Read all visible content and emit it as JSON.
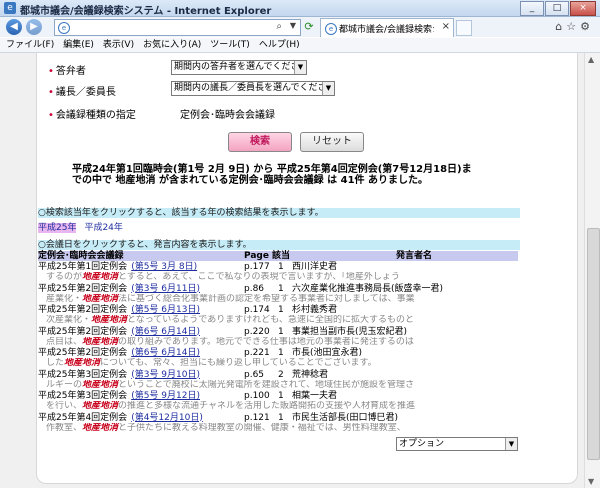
{
  "window": {
    "title": "都城市議会/会議録検索システム - Internet Explorer",
    "minimize": "_",
    "restore": "□",
    "close": "×"
  },
  "navbar": {
    "back": "◀",
    "forward": "▶",
    "address_placeholder": "",
    "tab_title": "都城市議会/会議録検索シ...",
    "tab_close": "×",
    "right_icons": "⌂☆⚙"
  },
  "menu": [
    "ファイル(F)",
    "編集(E)",
    "表示(V)",
    "お気に入り(A)",
    "ツール(T)",
    "ヘルプ(H)"
  ],
  "form": {
    "answerer_label": "答弁者",
    "answerer_select": "期間内の答弁者を選んでください",
    "chair_label": "議長／委員長",
    "chair_select": "期間内の議長／委員長を選んでください",
    "type_label": "会議録種類の指定",
    "type_value": "定例会･臨時会会議録",
    "search_button": "検索",
    "reset_button": "リセット"
  },
  "summary": "平成24年第1回臨時会(第1号 2月 9日)  から   平成25年第4回定例会(第7号12月18日)までの中で  地産地消  が含まれている定例会･臨時会会議録  は  41件  ありました。",
  "year_info": "○検索該当年をクリックすると、該当する年の検索結果を表示します。",
  "years": [
    "平成25年",
    "平成24年"
  ],
  "date_info": "○会議日をクリックすると、発言内容を表示します。",
  "columns": {
    "meeting": "定例会･臨時会会議録",
    "page": "Page",
    "hit": "該当",
    "speaker": "発言者名"
  },
  "results": [
    {
      "meeting": "平成25年第1回定例会",
      "date": "(第5号 3月 8日)",
      "page": "p.177",
      "hit": "1",
      "speaker": "西川洋史君",
      "snippet_pre": "するのが",
      "keyword": "地産地消",
      "snippet_post": "とすると、あえて、ここで私なりの表現で言いますが、「地産外しょう"
    },
    {
      "meeting": "平成25年第2回定例会",
      "date": "(第3号 6月11日)",
      "page": "p.86",
      "hit": "1",
      "speaker": "六次産業化推進事務局長(飯盛幸一君)",
      "snippet_pre": "産業化・",
      "keyword": "地産地消",
      "snippet_post": "法に基づく総合化事業計画の認定を希望する事業者に対しましては、事業"
    },
    {
      "meeting": "平成25年第2回定例会",
      "date": "(第5号 6月13日)",
      "page": "p.174",
      "hit": "1",
      "speaker": "杉村義秀君",
      "snippet_pre": "次産業化・",
      "keyword": "地産地消",
      "snippet_post": "となっているようでありますけれども、急速に全国的に拡大するものと"
    },
    {
      "meeting": "平成25年第2回定例会",
      "date": "(第6号 6月14日)",
      "page": "p.220",
      "hit": "1",
      "speaker": "事業担当副市長(児玉宏紀君)",
      "snippet_pre": "点目は、",
      "keyword": "地産地消",
      "snippet_post": "の取り組みであります。地元でできる仕事は地元の事業者に発注するのは"
    },
    {
      "meeting": "平成25年第2回定例会",
      "date": "(第6号 6月14日)",
      "page": "p.221",
      "hit": "1",
      "speaker": "市長(池田宜永君)",
      "snippet_pre": "した",
      "keyword": "地産地消",
      "snippet_post": "についても、常々、担当にも繰り返し申していることでございます。"
    },
    {
      "meeting": "平成25年第3回定例会",
      "date": "(第3号 9月10日)",
      "page": "p.65",
      "hit": "2",
      "speaker": "荒神稔君",
      "snippet_pre": "ルギーの",
      "keyword": "地産地消",
      "snippet_post": "ということで廃校に太陽光発電所を建設されて、地域住民が施設を管理さ"
    },
    {
      "meeting": "平成25年第3回定例会",
      "date": "(第5号 9月12日)",
      "page": "p.100",
      "hit": "1",
      "speaker": "相葉一夫君",
      "snippet_pre": "を行い、",
      "keyword": "地産地消",
      "snippet_post": "の推進と多様な流通チャネルを活用した販路開拓の支援や人材育成を推進"
    },
    {
      "meeting": "平成25年第4回定例会",
      "date": "(第4号12月10日)",
      "page": "p.121",
      "hit": "1",
      "speaker": "市民生活部長(田口博巳君)",
      "snippet_pre": "作教室、",
      "keyword": "地産地消",
      "snippet_post": "と子供たちに教える料理教室の開催、健康・福祉では、男性料理教室、"
    }
  ],
  "option_select": "オプション"
}
